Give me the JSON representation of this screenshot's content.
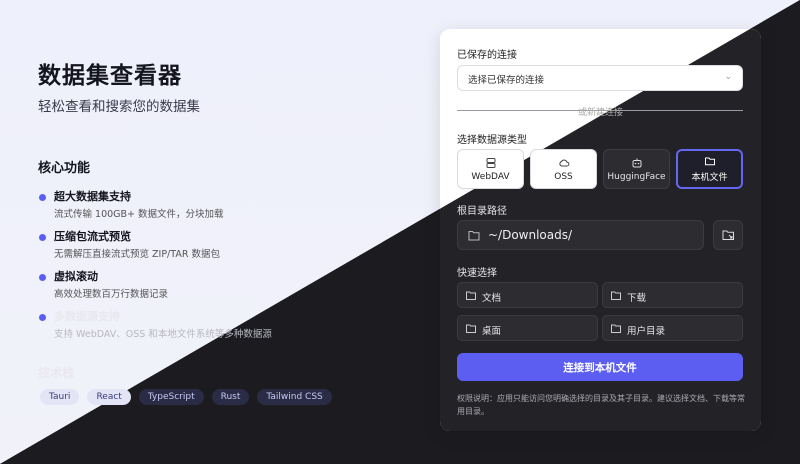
{
  "hero": {
    "title": "数据集查看器",
    "subtitle": "轻松查看和搜索您的数据集"
  },
  "features": {
    "heading": "核心功能",
    "items": [
      {
        "title": "超大数据集支持",
        "desc": "流式传输 100GB+ 数据文件，分块加载"
      },
      {
        "title": "压缩包流式预览",
        "desc": "无需解压直接流式预览 ZIP/TAR 数据包"
      },
      {
        "title": "虚拟滚动",
        "desc": "高效处理数百万行数据记录"
      },
      {
        "title": "多数据源支持",
        "desc": "支持 WebDAV、OSS 和本地文件系统等多种数据源"
      }
    ]
  },
  "tech": {
    "heading": "技术栈",
    "tags": [
      "Tauri",
      "React",
      "TypeScript",
      "Rust",
      "Tailwind CSS"
    ]
  },
  "panel": {
    "saved_label": "已保存的连接",
    "saved_placeholder": "选择已保存的连接",
    "divider_text": "或新建连接",
    "source_label": "选择数据源类型",
    "sources": [
      "WebDAV",
      "OSS",
      "HuggingFace",
      "本机文件"
    ],
    "active_source": "本机文件",
    "root_label": "根目录路径",
    "root_value": "~/Downloads/",
    "quick_label": "快速选择",
    "quick": [
      "文档",
      "下载",
      "桌面",
      "用户目录"
    ],
    "connect_label": "连接到本机文件",
    "note": "权限说明：应用只能访问您明确选择的目录及其子目录。建议选择文档、下载等常用目录。"
  },
  "colors": {
    "accent": "#5b5ef0",
    "light_bg": "#eef0fb",
    "dark_bg": "#1c1c20"
  }
}
